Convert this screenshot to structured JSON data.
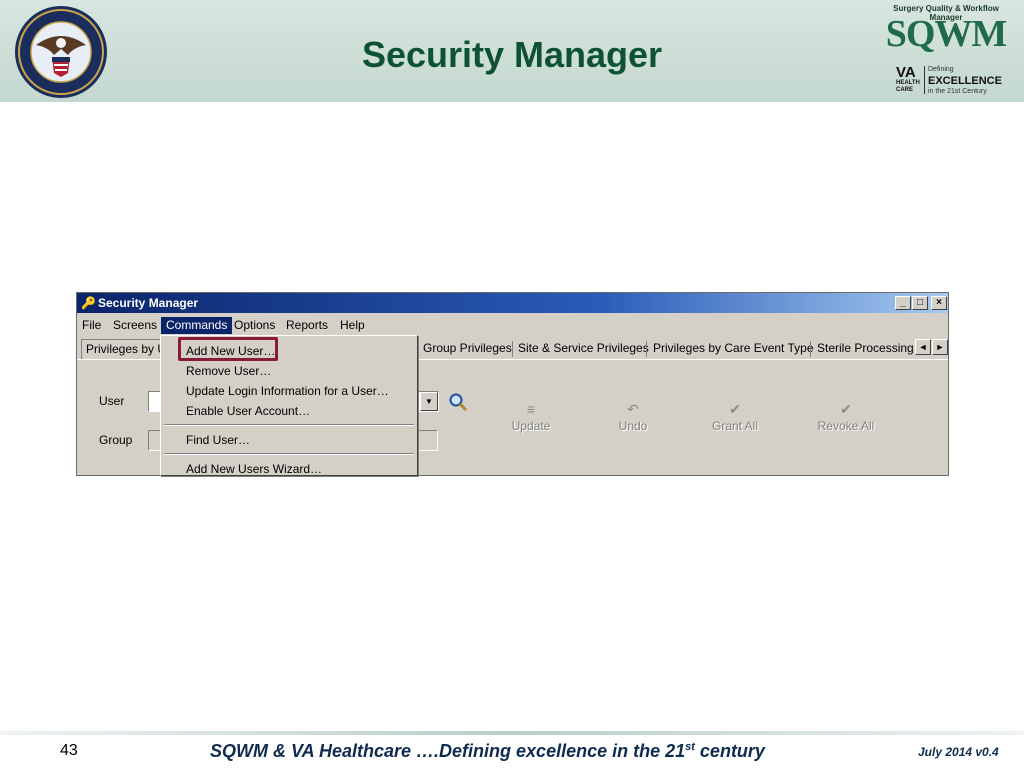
{
  "slide": {
    "title": "Security Manager",
    "page_number": "43",
    "footer_text_main": "SQWM & VA Healthcare ….Defining excellence in the 21",
    "footer_text_sup": "st",
    "footer_text_end": " century",
    "footer_date": "July 2014 v0.4"
  },
  "logo": {
    "subtitle": "Surgery Quality & Workflow Manager",
    "name": "SQWM",
    "va": "VA",
    "health_care": "HEALTH CARE",
    "defining": "Defining",
    "excellence": "EXCELLENCE",
    "century": "in the 21st Century"
  },
  "window": {
    "title": "Security Manager",
    "min_glyph": "_",
    "max_glyph": "□",
    "close_glyph": "×",
    "menu": [
      "File",
      "Screens",
      "Commands",
      "Options",
      "Reports",
      "Help"
    ],
    "active_menu": "Commands",
    "tabs": {
      "first": "Privileges by U",
      "group": "Group Privileges",
      "site": "Site & Service Privileges",
      "care": "Privileges by Care Event Type",
      "sterile": "Sterile Processing N"
    },
    "tab_left_arrow": "◄",
    "tab_right_arrow": "►",
    "user_label": "User",
    "group_label": "Group",
    "combo_arrow": "▼",
    "toolbar": {
      "update": "Update",
      "undo": "Undo",
      "grant_all": "Grant All",
      "revoke_all": "Revoke All"
    }
  },
  "dropdown": {
    "items": [
      "Add New User…",
      "Remove User…",
      "Update Login Information for a User…",
      "Enable User Account…",
      "Find User…",
      "Add New Users Wizard…"
    ],
    "highlighted": "Add New User…"
  },
  "colors": {
    "title_green": "#0f5233",
    "highlight_border": "#8b1a3a",
    "footer_navy": "#0f2c4e"
  }
}
